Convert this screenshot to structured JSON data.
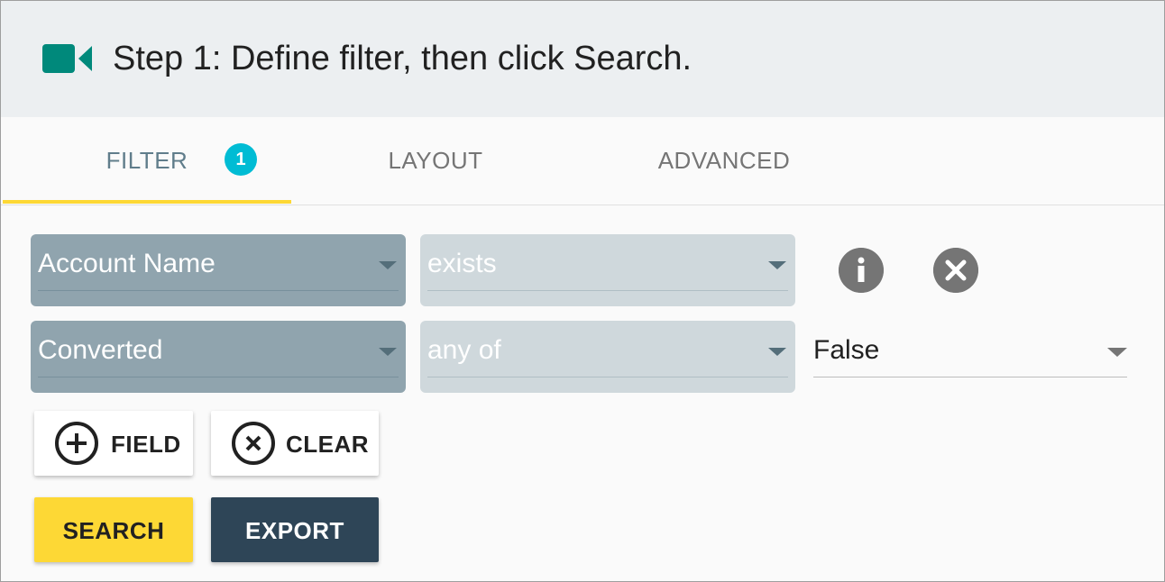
{
  "header": {
    "title": "Step 1: Define filter, then click Search.",
    "icon": "video-camera-icon",
    "icon_color": "#00897b"
  },
  "tabs": [
    {
      "label": "FILTER",
      "active": true,
      "badge": "1"
    },
    {
      "label": "LAYOUT",
      "active": false
    },
    {
      "label": "ADVANCED",
      "active": false
    }
  ],
  "filters": [
    {
      "field": "Account Name",
      "operator": "exists",
      "value": ""
    },
    {
      "field": "Converted",
      "operator": "any of",
      "value": "False"
    }
  ],
  "row_icons": [
    "info-icon",
    "close-circle-icon"
  ],
  "actions": {
    "add_field_label": "FIELD",
    "clear_label": "CLEAR",
    "search_label": "SEARCH",
    "export_label": "EXPORT"
  },
  "colors": {
    "accent": "#fdd835",
    "badge": "#00bcd4",
    "export_button": "#2e4557",
    "header_bg": "#eceff1"
  }
}
